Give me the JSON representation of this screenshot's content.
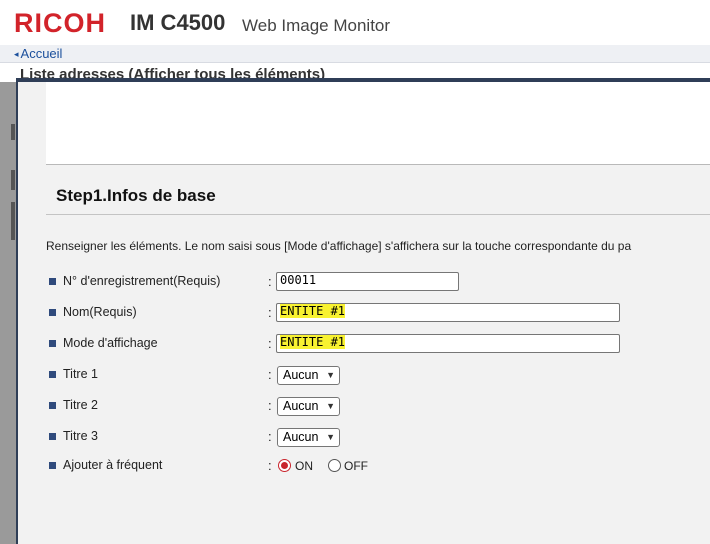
{
  "header": {
    "logo": "RICOH",
    "model": "IM C4500",
    "product": "Web Image Monitor",
    "brand_color": "#d2232a"
  },
  "nav": {
    "home_label": "Accueil"
  },
  "background": {
    "title": "Liste adresses (Afficher tous les éléments)"
  },
  "modal": {
    "step_title": "Step1.Infos de base",
    "instructions": "Renseigner les éléments. Le nom saisi sous [Mode d'affichage] s'affichera sur la touche correspondante du pa",
    "fields": {
      "registration_no": {
        "label": "N° d'enregistrement(Requis)",
        "value": "00011"
      },
      "name": {
        "label": "Nom(Requis)",
        "value": "ENTITE #1"
      },
      "display_mode": {
        "label": "Mode d'affichage",
        "value": "ENTITE #1"
      },
      "title1": {
        "label": "Titre 1",
        "value": "Aucun"
      },
      "title2": {
        "label": "Titre 2",
        "value": "Aucun"
      },
      "title3": {
        "label": "Titre 3",
        "value": "Aucun"
      },
      "frequent": {
        "label": "Ajouter à fréquent",
        "on_label": "ON",
        "off_label": "OFF",
        "selected": "ON"
      }
    },
    "colon": ":",
    "highlight_color": "#f8f231",
    "bullet_color": "#2f4a7c"
  }
}
